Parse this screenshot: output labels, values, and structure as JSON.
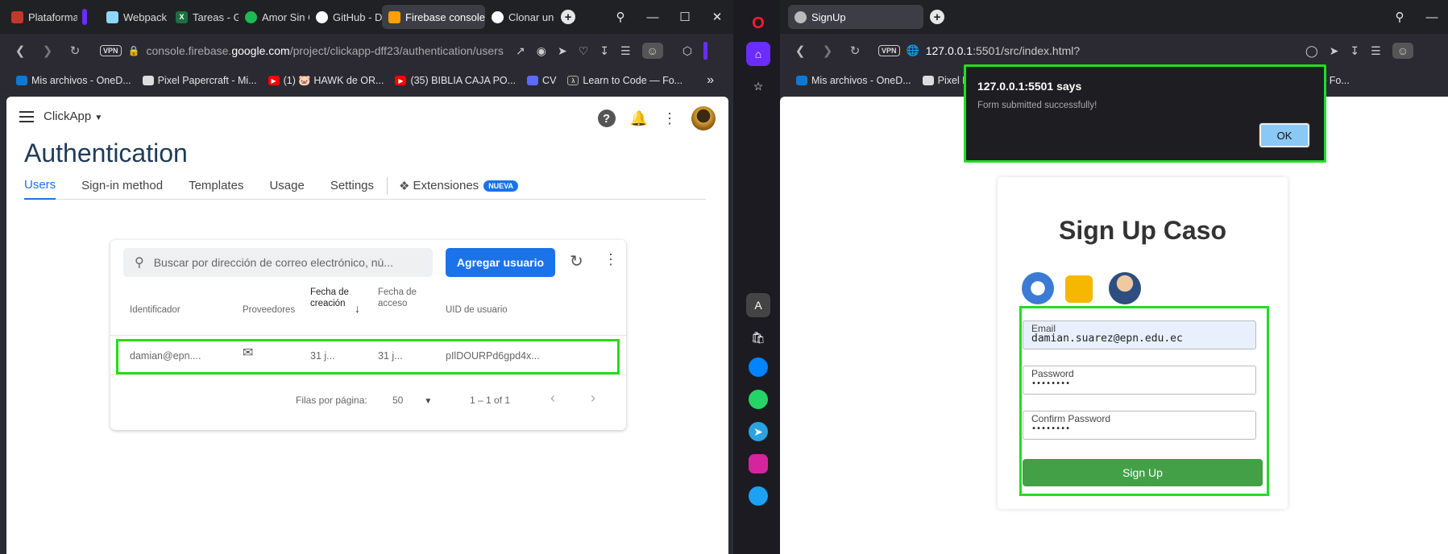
{
  "left_window": {
    "tabs": [
      {
        "label": "Plataforma",
        "color": "#c0392b"
      },
      {
        "label": "",
        "color": "#6a2cff"
      },
      {
        "label": "Webpack F",
        "color": "#8ed6fb"
      },
      {
        "label": "Tareas - G",
        "color": "#1d6f42"
      },
      {
        "label": "Amor Sin C",
        "color": "#1db954"
      },
      {
        "label": "GitHub - D",
        "color": "#ffffff"
      },
      {
        "label": "Firebase console",
        "color": "#ffa000"
      },
      {
        "label": "Clonar un",
        "color": "#ffffff"
      }
    ],
    "active_tab": "Firebase console",
    "url_prefix": "console.firebase.",
    "url_domain": "google.com",
    "url_path": "/project/clickapp-dff23/authentication/users",
    "vpn_label": "VPN",
    "bookmarks": [
      {
        "label": "Mis archivos - OneD...",
        "color": "#0a7ad9"
      },
      {
        "label": "Pixel Papercraft - Mi...",
        "color": "#dddddd"
      },
      {
        "label": "(1) 🐷 HAWK de OR...",
        "color": "#ff0000"
      },
      {
        "label": "(35) BIBLIA CAJA PO...",
        "color": "#ff0000"
      },
      {
        "label": "CV",
        "color": "#5b6bff"
      },
      {
        "label": "Learn to Code — Fo...",
        "color": "#333333"
      }
    ],
    "bookmarks_more": "»"
  },
  "firebase": {
    "app_name": "ClickApp",
    "page_title": "Authentication",
    "tabs": [
      "Users",
      "Sign-in method",
      "Templates",
      "Usage",
      "Settings"
    ],
    "extensions_label": "Extensiones",
    "extensions_badge": "NUEVA",
    "search_placeholder": "Buscar por dirección de correo electrónico, nú...",
    "add_user_label": "Agregar usuario",
    "columns": {
      "identifier": "Identificador",
      "providers": "Proveedores",
      "created": "Fecha de creación",
      "last_access": "Fecha de acceso",
      "uid": "UID de usuario"
    },
    "row": {
      "identifier": "damian@epn....",
      "created": "31 j...",
      "last_access": "31 j...",
      "uid": "pIlDOURPd6gpd4x..."
    },
    "rows_per_page_label": "Filas por página:",
    "rows_per_page_value": "50",
    "range_label": "1 – 1 of 1"
  },
  "right_window": {
    "tab_label": "SignUp",
    "url_host": "127.0.0.1",
    "url_rest": ":5501/src/index.html?",
    "vpn_label": "VPN",
    "bookmarks": [
      {
        "label": "Mis archivos - OneD...",
        "color": "#0a7ad9"
      },
      {
        "label": "Pixel Pap",
        "color": "#dddddd"
      },
      {
        "label": "earn to Code — Fo...",
        "color": "#333333"
      }
    ]
  },
  "signup": {
    "title": "Sign Up Caso",
    "email_label": "Email",
    "email_value": "damian.suarez@epn.edu.ec",
    "password_label": "Password",
    "password_value": "••••••••",
    "confirm_label": "Confirm Password",
    "confirm_value": "••••••••",
    "button_label": "Sign Up"
  },
  "dialog": {
    "title": "127.0.0.1:5501 says",
    "message": "Form submitted successfully!",
    "ok_label": "OK"
  },
  "colors": {
    "firebase_blue": "#1a73e8",
    "highlight_green": "#22dd22",
    "signup_green": "#43a047",
    "dialog_bg": "#1e1e22"
  }
}
